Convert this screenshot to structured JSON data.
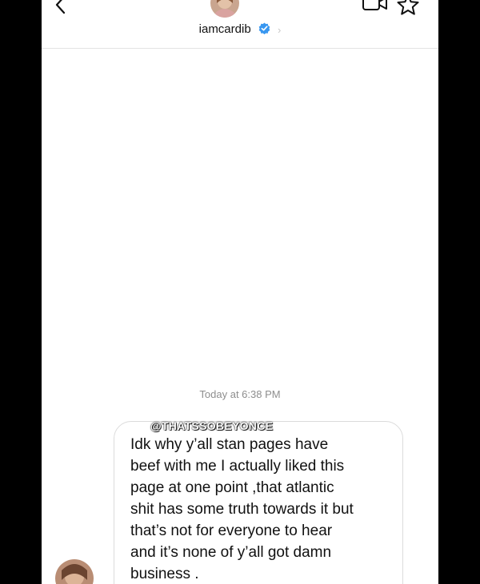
{
  "header": {
    "username": "iamcardib",
    "verified": true,
    "back_icon": "chevron-left-icon",
    "video_icon": "video-call-icon",
    "star_icon": "star-icon"
  },
  "thread": {
    "timestamp": "Today at 6:38 PM",
    "message": {
      "text": "Idk why y’all stan pages have\nbeef with me I actually liked this\npage at one point ,that atlantic\nshit has some truth towards it but\nthat’s not for everyone to hear\nand it’s none of y’all got damn\nbusiness .",
      "watermark": "@THATSSOBEYONCE"
    }
  },
  "colors": {
    "accent_verified": "#3897f0",
    "border": "#dbdbdb",
    "muted_text": "#8e8e8e"
  }
}
